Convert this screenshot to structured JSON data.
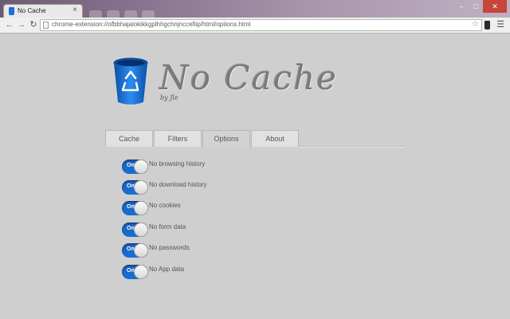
{
  "browser": {
    "tab_title": "No Cache",
    "tab_close": "×",
    "url": "chrome-extension://ofbbhajalokikkgplhhgchnjnccefiip/html/options.html",
    "window_controls": [
      "–",
      "□",
      "✕"
    ]
  },
  "header": {
    "title": "No Cache",
    "byline": "by Jle"
  },
  "tabs": [
    {
      "label": "Cache"
    },
    {
      "label": "Filters"
    },
    {
      "label": "Options"
    },
    {
      "label": "About"
    }
  ],
  "active_tab": "Options",
  "options": [
    {
      "state": "On",
      "label": "No browsing history"
    },
    {
      "state": "On",
      "label": "No download history"
    },
    {
      "state": "On",
      "label": "No cookies"
    },
    {
      "state": "On",
      "label": "No form data"
    },
    {
      "state": "On",
      "label": "No passwords"
    },
    {
      "state": "On",
      "label": "No App data"
    }
  ],
  "colors": {
    "accent": "#1f65c4",
    "page_background": "#cfcfcf"
  }
}
